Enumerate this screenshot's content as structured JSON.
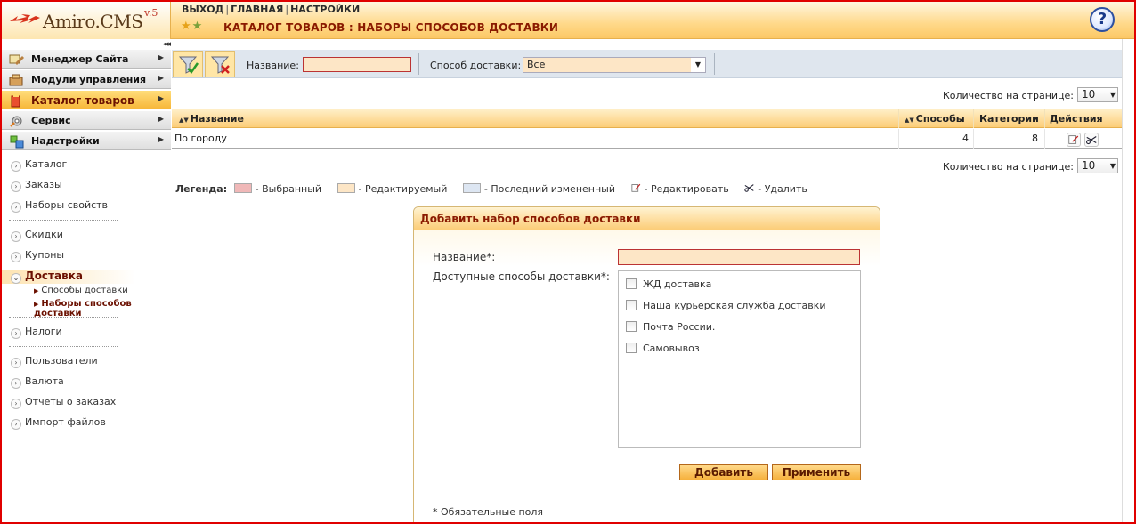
{
  "brand": {
    "name": "Amiro.CMS",
    "version": "v.5"
  },
  "topnav": {
    "exit": "ВЫХОД",
    "home": "ГЛАВНАЯ",
    "settings": "НАСТРОЙКИ"
  },
  "page_title": "КАТАЛОГ ТОВАРОВ : НАБОРЫ СПОСОБОВ ДОСТАВКИ",
  "help_label": "?",
  "sidebar": {
    "collapse": "◂◂◂",
    "menu": [
      {
        "label": "Менеджер Сайта",
        "icon": "site-manager-icon"
      },
      {
        "label": "Модули управления",
        "icon": "modules-icon"
      },
      {
        "label": "Каталог товаров",
        "icon": "catalog-icon",
        "active": true
      },
      {
        "label": "Сервис",
        "icon": "service-icon"
      },
      {
        "label": "Надстройки",
        "icon": "addons-icon"
      }
    ],
    "links_group1": [
      "Каталог",
      "Заказы",
      "Наборы свойств"
    ],
    "links_group2": [
      "Скидки",
      "Купоны"
    ],
    "active_section": "Доставка",
    "sub_items": [
      "Способы доставки",
      "Наборы способов доставки"
    ],
    "links_group3": [
      "Налоги"
    ],
    "links_group4": [
      "Пользователи",
      "Валюта",
      "Отчеты о заказах",
      "Импорт файлов"
    ]
  },
  "filter": {
    "name_label": "Название:",
    "name_value": "",
    "delivery_label": "Способ доставки:",
    "delivery_value": "Все"
  },
  "per_page": {
    "label": "Количество на странице:",
    "value": "10"
  },
  "grid": {
    "columns": [
      "Название",
      "Способы",
      "Категории",
      "Действия"
    ],
    "rows": [
      {
        "name": "По городу",
        "methods": "4",
        "categories": "8"
      }
    ]
  },
  "legend": {
    "title": "Легенда:",
    "selected": "- Выбранный",
    "editing": "- Редактируемый",
    "last_changed": "- Последний измененный",
    "edit": "- Редактировать",
    "delete": "- Удалить",
    "colors": {
      "selected": "#f0b8b8",
      "editing": "#fde6c6",
      "last_changed": "#dde6f2"
    }
  },
  "form": {
    "title": "Добавить набор способов доставки",
    "name_label": "Название*:",
    "name_value": "",
    "methods_label": "Доступные способы доставки*:",
    "methods": [
      "ЖД доставка",
      "Наша курьерская служба доставки",
      "Почта России.",
      "Самовывоз"
    ],
    "add_button": "Добавить",
    "apply_button": "Применить",
    "required_note": "* Обязательные поля"
  }
}
